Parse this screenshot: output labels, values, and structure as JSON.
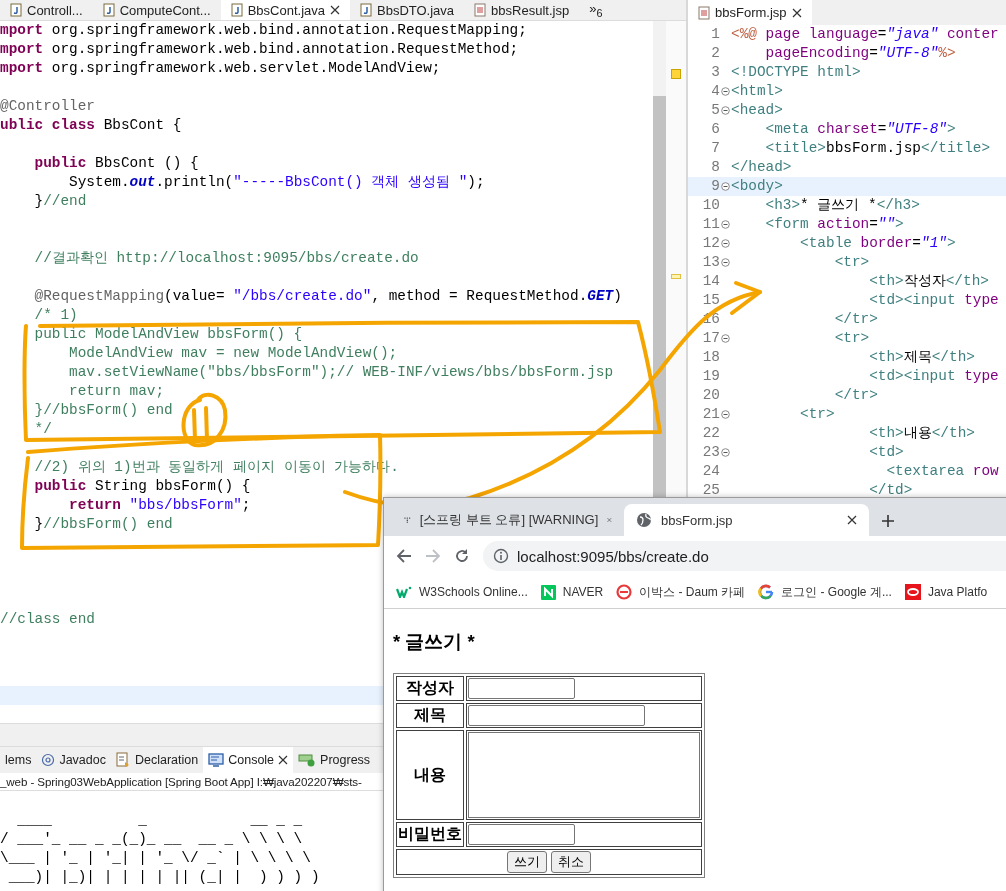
{
  "left_editor": {
    "tabs": [
      {
        "label": "Controll...",
        "selected": false,
        "kind": "java"
      },
      {
        "label": "ComputeCont...",
        "selected": false,
        "kind": "java"
      },
      {
        "label": "BbsCont.java",
        "selected": true,
        "kind": "java"
      },
      {
        "label": "BbsDTO.java",
        "selected": false,
        "kind": "java"
      },
      {
        "label": "bbsResult.jsp",
        "selected": false,
        "kind": "jsp"
      },
      {
        "label": "»$_{6}$",
        "selected": false,
        "kind": "overflow"
      }
    ],
    "lines": [
      {
        "tokens": [
          {
            "kind": "kw",
            "text": "mport"
          },
          {
            "kind": "plain",
            "text": " org.springframework.web.bind.annotation.RequestMapping;"
          }
        ],
        "current": false
      },
      {
        "tokens": [
          {
            "kind": "kw",
            "text": "mport"
          },
          {
            "kind": "plain",
            "text": " org.springframework.web.bind.annotation.RequestMethod;"
          }
        ],
        "current": false
      },
      {
        "tokens": [
          {
            "kind": "kw",
            "text": "mport"
          },
          {
            "kind": "plain",
            "text": " org.springframework.web.servlet.ModelAndView;"
          }
        ],
        "current": false
      },
      {
        "current": false
      },
      {
        "tokens": [
          {
            "kind": "ann",
            "text": "@Controller"
          }
        ],
        "current": false
      },
      {
        "tokens": [
          {
            "kind": "kw",
            "text": "ublic"
          },
          {
            "kind": "kw",
            "text": " class"
          },
          {
            "kind": "plain",
            "text": " BbsCont {"
          }
        ],
        "current": false
      },
      {
        "current": false
      },
      {
        "tokens": [
          {
            "kind": "kw",
            "text": "    public"
          },
          {
            "kind": "plain",
            "text": " BbsCont () {"
          }
        ],
        "current": false
      },
      {
        "tokens": [
          {
            "kind": "plain",
            "text": "        System."
          },
          {
            "kind": "field",
            "text": "out"
          },
          {
            "kind": "plain",
            "text": ".println("
          },
          {
            "kind": "str",
            "text": "\"-----BbsCont() 객체 생성됨 \""
          },
          {
            "kind": "plain",
            "text": ");"
          }
        ],
        "current": false
      },
      {
        "tokens": [
          {
            "kind": "plain",
            "text": "    }"
          },
          {
            "kind": "comment",
            "text": "//end"
          }
        ],
        "current": false
      },
      {
        "current": false
      },
      {
        "current": false
      },
      {
        "tokens": [
          {
            "kind": "comment",
            "text": "    //결과확인 http://localhost:9095/bbs/create.do"
          }
        ],
        "current": false
      },
      {
        "current": false
      },
      {
        "tokens": [
          {
            "kind": "ann",
            "text": "    @RequestMapping"
          },
          {
            "kind": "plain",
            "text": "(value= "
          },
          {
            "kind": "str",
            "text": "\"/bbs/create.do\""
          },
          {
            "kind": "plain",
            "text": ", method = RequestMethod."
          },
          {
            "kind": "field",
            "text": "GET"
          },
          {
            "kind": "plain",
            "text": ")"
          }
        ],
        "current": false
      },
      {
        "tokens": [
          {
            "kind": "comment",
            "text": "    /* 1)"
          }
        ],
        "current": false
      },
      {
        "tokens": [
          {
            "kind": "comment",
            "text": "    public ModelAndView bbsForm() {"
          }
        ],
        "current": false
      },
      {
        "tokens": [
          {
            "kind": "comment",
            "text": "        ModelAndView mav = new ModelAndView();"
          }
        ],
        "current": false
      },
      {
        "tokens": [
          {
            "kind": "comment",
            "text": "        mav.setViewName(\"bbs/bbsForm\");// WEB-INF/views/bbs/bbsForm.jsp"
          }
        ],
        "current": false
      },
      {
        "tokens": [
          {
            "kind": "comment",
            "text": "        return mav;"
          }
        ],
        "current": false
      },
      {
        "tokens": [
          {
            "kind": "comment",
            "text": "    }//bbsForm() end"
          }
        ],
        "current": false
      },
      {
        "tokens": [
          {
            "kind": "comment",
            "text": "    */"
          }
        ],
        "current": false
      },
      {
        "current": false
      },
      {
        "tokens": [
          {
            "kind": "comment",
            "text": "    //2) 위의 1)번과 동일하게 페이지 이동이 가능하다."
          }
        ],
        "current": false
      },
      {
        "tokens": [
          {
            "kind": "kw",
            "text": "    public"
          },
          {
            "kind": "plain",
            "text": " String bbsForm() {"
          }
        ],
        "current": false
      },
      {
        "tokens": [
          {
            "kind": "kw",
            "text": "        return"
          },
          {
            "kind": "str",
            "text": " \"bbs/bbsForm\""
          },
          {
            "kind": "plain",
            "text": ";"
          }
        ],
        "current": false
      },
      {
        "tokens": [
          {
            "kind": "plain",
            "text": "    }"
          },
          {
            "kind": "comment",
            "text": "//bbsForm() end"
          }
        ],
        "current": false
      },
      {
        "current": false
      },
      {
        "current": false
      },
      {
        "current": false
      },
      {
        "current": false
      },
      {
        "tokens": [
          {
            "kind": "comment",
            "text": "//class end"
          }
        ],
        "current": false
      },
      {
        "current": false
      },
      {
        "current": false
      },
      {
        "current": false
      },
      {
        "current": true
      }
    ]
  },
  "right_editor": {
    "tabs": [
      {
        "label": "bbsForm.jsp",
        "selected": true
      }
    ],
    "lines": [
      {
        "number": "1",
        "fold": false,
        "current": false,
        "tokens": [
          {
            "kind": "jsp",
            "text": "<%@"
          },
          {
            "kind": "attr",
            "text": " page language"
          },
          {
            "kind": "plain",
            "text": "="
          },
          {
            "kind": "val",
            "text": "\"java\""
          },
          {
            "kind": "attr",
            "text": " conter"
          }
        ]
      },
      {
        "number": "2",
        "fold": false,
        "current": false,
        "tokens": [
          {
            "kind": "attr",
            "text": "    pageEncoding"
          },
          {
            "kind": "plain",
            "text": "="
          },
          {
            "kind": "val",
            "text": "\"UTF-8\""
          },
          {
            "kind": "jsp",
            "text": "%>"
          }
        ]
      },
      {
        "number": "3",
        "fold": false,
        "current": false,
        "tokens": [
          {
            "kind": "tag",
            "text": "<!DOCTYPE html>"
          }
        ]
      },
      {
        "number": "4",
        "fold": true,
        "current": false,
        "tokens": [
          {
            "kind": "tag",
            "text": "<html>"
          }
        ]
      },
      {
        "number": "5",
        "fold": true,
        "current": false,
        "tokens": [
          {
            "kind": "tag",
            "text": "<head>"
          }
        ]
      },
      {
        "number": "6",
        "fold": false,
        "current": false,
        "tokens": [
          {
            "kind": "tag",
            "text": "    <meta"
          },
          {
            "kind": "attr",
            "text": " charset"
          },
          {
            "kind": "plain",
            "text": "="
          },
          {
            "kind": "val",
            "text": "\"UTF-8\""
          },
          {
            "kind": "tag",
            "text": ">"
          }
        ]
      },
      {
        "number": "7",
        "fold": false,
        "current": false,
        "tokens": [
          {
            "kind": "tag",
            "text": "    <title>"
          },
          {
            "kind": "plain",
            "text": "bbsForm.jsp"
          },
          {
            "kind": "tag",
            "text": "</title>"
          }
        ]
      },
      {
        "number": "8",
        "fold": false,
        "current": false,
        "tokens": [
          {
            "kind": "tag",
            "text": "</head>"
          }
        ]
      },
      {
        "number": "9",
        "fold": true,
        "current": true,
        "tokens": [
          {
            "kind": "tag",
            "text": "<body>"
          }
        ]
      },
      {
        "number": "10",
        "fold": false,
        "current": false,
        "tokens": [
          {
            "kind": "tag",
            "text": "    <h3>"
          },
          {
            "kind": "plain",
            "text": "* 글쓰기 *"
          },
          {
            "kind": "tag",
            "text": "</h3>"
          }
        ]
      },
      {
        "number": "11",
        "fold": true,
        "current": false,
        "tokens": [
          {
            "kind": "tag",
            "text": "    <form"
          },
          {
            "kind": "attr",
            "text": " action"
          },
          {
            "kind": "plain",
            "text": "="
          },
          {
            "kind": "val",
            "text": "\"\""
          },
          {
            "kind": "tag",
            "text": ">"
          }
        ]
      },
      {
        "number": "12",
        "fold": true,
        "current": false,
        "tokens": [
          {
            "kind": "tag",
            "text": "        <table"
          },
          {
            "kind": "attr",
            "text": " border"
          },
          {
            "kind": "plain",
            "text": "="
          },
          {
            "kind": "val",
            "text": "\"1\""
          },
          {
            "kind": "tag",
            "text": ">"
          }
        ]
      },
      {
        "number": "13",
        "fold": true,
        "current": false,
        "tokens": [
          {
            "kind": "tag",
            "text": "            <tr>"
          }
        ]
      },
      {
        "number": "14",
        "fold": false,
        "current": false,
        "tokens": [
          {
            "kind": "tag",
            "text": "                <th>"
          },
          {
            "kind": "plain",
            "text": "작성자"
          },
          {
            "kind": "tag",
            "text": "</th>"
          }
        ]
      },
      {
        "number": "15",
        "fold": false,
        "current": false,
        "tokens": [
          {
            "kind": "tag",
            "text": "                <td><input"
          },
          {
            "kind": "attr",
            "text": " type"
          }
        ]
      },
      {
        "number": "16",
        "fold": false,
        "current": false,
        "tokens": [
          {
            "kind": "tag",
            "text": "            </tr>"
          }
        ]
      },
      {
        "number": "17",
        "fold": true,
        "current": false,
        "tokens": [
          {
            "kind": "tag",
            "text": "            <tr>"
          }
        ]
      },
      {
        "number": "18",
        "fold": false,
        "current": false,
        "tokens": [
          {
            "kind": "tag",
            "text": "                <th>"
          },
          {
            "kind": "plain",
            "text": "제목"
          },
          {
            "kind": "tag",
            "text": "</th>"
          }
        ]
      },
      {
        "number": "19",
        "fold": false,
        "current": false,
        "tokens": [
          {
            "kind": "tag",
            "text": "                <td><input"
          },
          {
            "kind": "attr",
            "text": " type"
          }
        ]
      },
      {
        "number": "20",
        "fold": false,
        "current": false,
        "tokens": [
          {
            "kind": "tag",
            "text": "            </tr>"
          }
        ]
      },
      {
        "number": "21",
        "fold": true,
        "current": false,
        "tokens": [
          {
            "kind": "tag",
            "text": "        <tr>"
          }
        ]
      },
      {
        "number": "22",
        "fold": false,
        "current": false,
        "tokens": [
          {
            "kind": "tag",
            "text": "                <th>"
          },
          {
            "kind": "plain",
            "text": "내용"
          },
          {
            "kind": "tag",
            "text": "</th>"
          }
        ]
      },
      {
        "number": "23",
        "fold": true,
        "current": false,
        "tokens": [
          {
            "kind": "tag",
            "text": "                <td>"
          }
        ]
      },
      {
        "number": "24",
        "fold": false,
        "current": false,
        "tokens": [
          {
            "kind": "tag",
            "text": "                  <textarea"
          },
          {
            "kind": "attr",
            "text": " row"
          }
        ]
      },
      {
        "number": "25",
        "fold": false,
        "current": false,
        "tokens": [
          {
            "kind": "tag",
            "text": "                </td>"
          }
        ]
      }
    ]
  },
  "bottom_panel": {
    "tabs": [
      {
        "label": "lems",
        "selected": false,
        "kind": "problems"
      },
      {
        "label": "Javadoc",
        "selected": false,
        "kind": "javadoc"
      },
      {
        "label": "Declaration",
        "selected": false,
        "kind": "declaration"
      },
      {
        "label": "Console",
        "selected": true,
        "kind": "console"
      },
      {
        "label": "Progress",
        "selected": false,
        "kind": "progress"
      }
    ],
    "console_title": "_web - Spring03WebApplication [Spring Boot App] I:₩java202207₩sts-",
    "console_output": "  ____          _            __ _ _\n/ ___'_ __ _ _(_)_ __  __ _ \\ \\ \\ \\\n\\___ | '_ | '_| | '_ \\/ _` | \\ \\ \\ \\\n ___)| |_)| | | | | || (_| |  ) ) ) )"
  },
  "browser": {
    "tabs": [
      {
        "title": "[스프링 부트 오류] [WARNING]",
        "selected": false,
        "kind": "dots"
      },
      {
        "title": "bbsForm.jsp",
        "selected": true,
        "kind": "globe"
      }
    ],
    "address": "localhost:9095/bbs/create.do",
    "bookmarks": [
      {
        "label": "W3Schools Online...",
        "kind": "w3"
      },
      {
        "label": "NAVER",
        "kind": "square"
      },
      {
        "label": "이박스 - Daum 카페",
        "kind": "ring"
      },
      {
        "label": "로그인 - Google 계...",
        "kind": "g"
      },
      {
        "label": "Java Platfo",
        "kind": "oval"
      }
    ],
    "page": {
      "heading": "* 글쓰기 *",
      "form_rows": [
        {
          "label": "작성자",
          "kind": "short-input"
        },
        {
          "label": "제목",
          "kind": "long-input"
        },
        {
          "label": "내용",
          "kind": "textarea"
        },
        {
          "label": "비밀번호",
          "kind": "short-input"
        }
      ],
      "buttons": [
        "쓰기",
        "취소"
      ]
    }
  }
}
